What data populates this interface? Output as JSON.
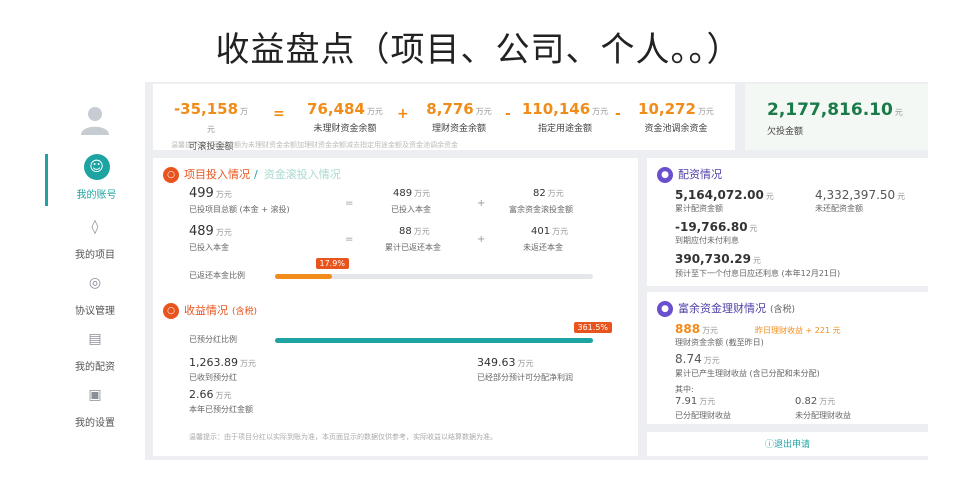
{
  "slide_title": "收益盘点（项目、公司、个人。。）",
  "sidebar": {
    "items": [
      {
        "label": "我的账号",
        "icon": "user-icon"
      },
      {
        "label": "我的项目",
        "icon": "layers-icon"
      },
      {
        "label": "协议管理",
        "icon": "bag-icon"
      },
      {
        "label": "我的配资",
        "icon": "card-icon"
      },
      {
        "label": "我的设置",
        "icon": "settings-icon"
      }
    ]
  },
  "summary": {
    "stats": [
      {
        "value": "-35,158",
        "unit": "万元",
        "label": "可滚投金额"
      },
      {
        "value": "76,484",
        "unit": "万元",
        "label": "未理财资金余额"
      },
      {
        "value": "8,776",
        "unit": "万元",
        "label": "理财资金余额"
      },
      {
        "value": "110,146",
        "unit": "万元",
        "label": "指定用途金额"
      },
      {
        "value": "10,272",
        "unit": "万元",
        "label": "资金池调余资金"
      }
    ],
    "ops": [
      "=",
      "+",
      "-",
      "-"
    ],
    "tip": "温馨提示：可滚投金额为未理财资金余额加理财资金余额减去指定用途金额及资金池调余资金"
  },
  "debt": {
    "value": "2,177,816.10",
    "unit": "元",
    "label": "欠投金额"
  },
  "investment": {
    "title": "项目投入情况",
    "separator": "/",
    "tab2": "资金滚投入情况",
    "row1": {
      "total": "499",
      "total_unit": "万元",
      "total_label": "已投项目总额 (本金 + 滚投)",
      "a": "489",
      "a_unit": "万元",
      "a_label": "已投入本金",
      "b": "82",
      "b_unit": "万元",
      "b_label": "富余资金滚投金额"
    },
    "row2": {
      "total": "489",
      "total_unit": "万元",
      "total_label": "已投入本金",
      "a": "88",
      "a_unit": "万元",
      "a_label": "累计已返还本金",
      "b": "401",
      "b_unit": "万元",
      "b_label": "未返还本金"
    },
    "return_ratio_label": "已返还本金比例",
    "return_ratio_text": "17.9%",
    "return_ratio": 0.179
  },
  "income": {
    "title": "收益情况",
    "suffix": "(含税)",
    "ratio_label": "已预分红比例",
    "ratio_text": "361.5%",
    "ratio": 1.0,
    "received": "1,263.89",
    "received_unit": "万元",
    "received_label": "已收到预分红",
    "year": "2.66",
    "year_unit": "万元",
    "year_label": "本年已预分红金额",
    "partial": "349.63",
    "partial_unit": "万元",
    "partial_label": "已经部分预计可分配净利润",
    "note": "温馨提示：由于项目分红以实际到账为准，本页面显示的数据仅供参考，实际收益以结算数据为准。"
  },
  "allocation": {
    "title": "配资情况",
    "v1": "5,164,072.00",
    "v1_unit": "元",
    "v1_label": "累计配资金额",
    "v2": "4,332,397.50",
    "v2_unit": "元",
    "v2_label": "未还配资金额",
    "v3": "-19,766.80",
    "v3_unit": "元",
    "v3_label": "到期应付未付利息",
    "v4": "390,730.29",
    "v4_unit": "元",
    "v4_label": "预计至下一个付息日应还利息 (本年12月21日)"
  },
  "surplus": {
    "title": "富余资金理财情况",
    "suffix": "(含税)",
    "v1": "888",
    "v1_unit": "万元",
    "v1_extra": "昨日理财收益 + 221 元",
    "v1_label": "理财资金余额 (截至昨日)",
    "v2": "8.74",
    "v2_unit": "万元",
    "v2_label": "累计已产生理财收益 (含已分配和未分配)",
    "among": "其中:",
    "v3": "7.91",
    "v3_unit": "万元",
    "v3_label": "已分配理财收益",
    "v4": "0.82",
    "v4_unit": "万元",
    "v4_label": "未分配理财收益"
  },
  "exit_label": "ⓘ退出申请",
  "colors": {
    "accent": "#1ea3a3",
    "orange": "#f08c1a",
    "red": "#e8541e",
    "purple": "#6a4fcf"
  }
}
